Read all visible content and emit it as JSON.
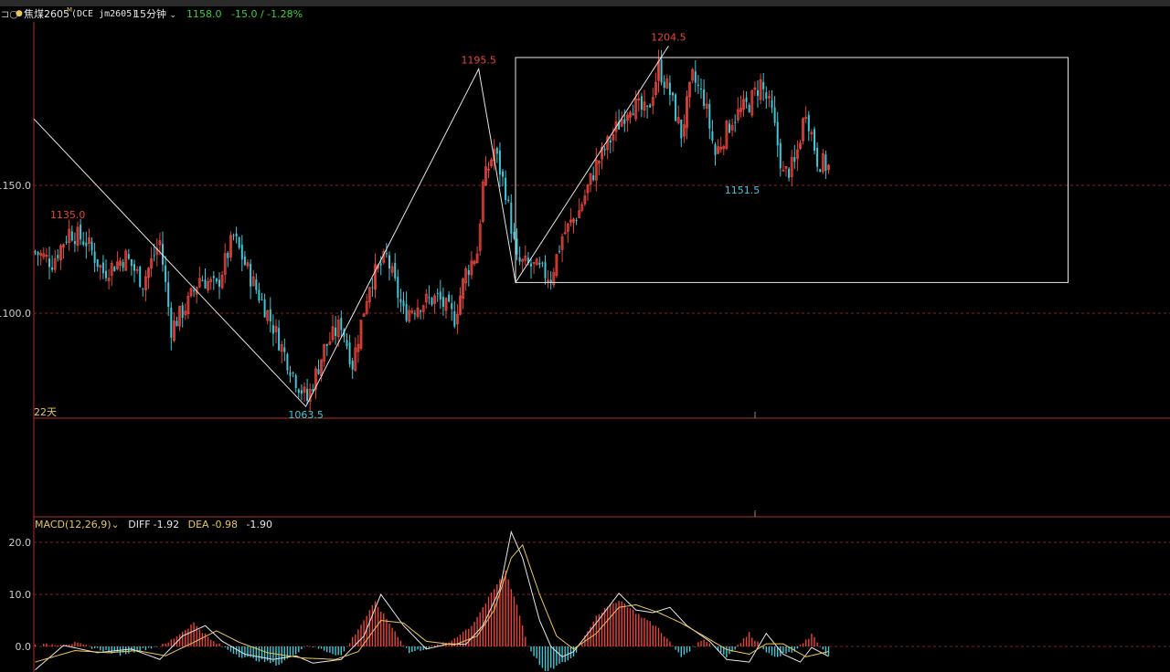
{
  "header": {
    "window_icon": "⊐○",
    "dot": "●",
    "symbol": "焦煤2605",
    "symbol_suffix": "M",
    "exchange_code": "(DCE jm2605)",
    "period": "15分钟",
    "last_price": "1158.0",
    "change": "-15.0 / -1.28%"
  },
  "colors": {
    "up": "#e8443a",
    "down": "#3ec8d8",
    "grid": "#8a1f1f",
    "axis": "#b03030",
    "white": "#e6e6e6",
    "yellow": "#e8c75a",
    "green_text": "#38d238"
  },
  "volume_panel": {
    "label": "22天"
  },
  "macd": {
    "label": "MACD(12,26,9)",
    "diff_label": "DIFF",
    "diff_value": "-1.92",
    "dea_label": "DEA",
    "dea_value": "-0.98",
    "macd_value": "-1.90"
  },
  "chart_data": {
    "type": "candlestick",
    "price_ticks": [
      "1150.0",
      "1100.0"
    ],
    "price_tick_values": [
      1150,
      1100
    ],
    "macd_ticks": [
      "20.0",
      "10.0",
      "0.0"
    ],
    "macd_tick_values": [
      20,
      10,
      0
    ],
    "bar_count": 260,
    "price_range": [
      1058,
      1212
    ],
    "macd_range": [
      -5,
      23
    ],
    "annotations": [
      {
        "text": "1135.0",
        "bar": 12,
        "value": 1135.0,
        "kind": "high"
      },
      {
        "text": "1063.5",
        "bar": 96,
        "value": 1063.5,
        "kind": "low"
      },
      {
        "text": "1195.5",
        "bar": 157,
        "value": 1195.5,
        "kind": "high"
      },
      {
        "text": "1204.5",
        "bar": 224,
        "value": 1204.5,
        "kind": "high"
      },
      {
        "text": "1151.5",
        "bar": 250,
        "value": 1151.5,
        "kind": "low"
      }
    ],
    "zigzag": [
      {
        "bar": 0,
        "value": 1176
      },
      {
        "bar": 96,
        "value": 1063.5
      },
      {
        "bar": 157,
        "value": 1195.5
      },
      {
        "bar": 170,
        "value": 1112
      },
      {
        "bar": 224,
        "value": 1204.5
      }
    ],
    "box": {
      "bar_start": 170,
      "bar_end": 365,
      "high": 1200,
      "low": 1112
    },
    "price_anchors": [
      [
        0,
        1124
      ],
      [
        6,
        1120
      ],
      [
        12,
        1132
      ],
      [
        18,
        1128
      ],
      [
        24,
        1116
      ],
      [
        32,
        1122
      ],
      [
        38,
        1112
      ],
      [
        44,
        1128
      ],
      [
        48,
        1094
      ],
      [
        54,
        1104
      ],
      [
        58,
        1114
      ],
      [
        64,
        1110
      ],
      [
        70,
        1130
      ],
      [
        76,
        1114
      ],
      [
        82,
        1100
      ],
      [
        88,
        1084
      ],
      [
        92,
        1074
      ],
      [
        96,
        1066
      ],
      [
        102,
        1086
      ],
      [
        108,
        1096
      ],
      [
        112,
        1080
      ],
      [
        118,
        1112
      ],
      [
        124,
        1122
      ],
      [
        130,
        1100
      ],
      [
        136,
        1104
      ],
      [
        142,
        1106
      ],
      [
        148,
        1098
      ],
      [
        152,
        1116
      ],
      [
        156,
        1124
      ],
      [
        158,
        1150
      ],
      [
        162,
        1164
      ],
      [
        166,
        1148
      ],
      [
        170,
        1120
      ],
      [
        176,
        1118
      ],
      [
        182,
        1114
      ],
      [
        186,
        1130
      ],
      [
        192,
        1140
      ],
      [
        198,
        1158
      ],
      [
        204,
        1170
      ],
      [
        210,
        1182
      ],
      [
        216,
        1178
      ],
      [
        220,
        1196
      ],
      [
        224,
        1186
      ],
      [
        228,
        1170
      ],
      [
        232,
        1192
      ],
      [
        236,
        1184
      ],
      [
        240,
        1162
      ],
      [
        246,
        1176
      ],
      [
        252,
        1182
      ],
      [
        256,
        1190
      ],
      [
        260,
        1178
      ],
      [
        264,
        1154
      ],
      [
        268,
        1158
      ],
      [
        272,
        1180
      ],
      [
        276,
        1160
      ],
      [
        280,
        1157
      ]
    ],
    "macd_anchors": [
      [
        0,
        0.2
      ],
      [
        14,
        0.6
      ],
      [
        30,
        -1.5
      ],
      [
        46,
        0.4
      ],
      [
        56,
        4.5
      ],
      [
        62,
        1.2
      ],
      [
        72,
        -1.8
      ],
      [
        86,
        -3.5
      ],
      [
        96,
        0.3
      ],
      [
        108,
        -1.8
      ],
      [
        120,
        8.5
      ],
      [
        132,
        -1.2
      ],
      [
        146,
        0.8
      ],
      [
        154,
        4
      ],
      [
        162,
        11
      ],
      [
        166,
        14.5
      ],
      [
        170,
        8
      ],
      [
        174,
        0
      ],
      [
        180,
        -5
      ],
      [
        190,
        -2
      ],
      [
        198,
        6
      ],
      [
        206,
        9
      ],
      [
        212,
        6.5
      ],
      [
        220,
        3.5
      ],
      [
        228,
        -2
      ],
      [
        236,
        1.5
      ],
      [
        244,
        -2
      ],
      [
        252,
        2.5
      ],
      [
        260,
        -2
      ],
      [
        268,
        -1
      ],
      [
        274,
        2.2
      ],
      [
        280,
        -1.9
      ]
    ],
    "diff_anchors": [
      [
        0,
        -4.5
      ],
      [
        10,
        0.2
      ],
      [
        22,
        -1.2
      ],
      [
        34,
        -0.5
      ],
      [
        44,
        -2.5
      ],
      [
        52,
        2
      ],
      [
        60,
        4
      ],
      [
        66,
        1
      ],
      [
        74,
        -1.5
      ],
      [
        84,
        -2.5
      ],
      [
        92,
        -1.8
      ],
      [
        98,
        -3.2
      ],
      [
        108,
        -2.5
      ],
      [
        116,
        2
      ],
      [
        122,
        10
      ],
      [
        130,
        4
      ],
      [
        138,
        -0.5
      ],
      [
        146,
        0.5
      ],
      [
        152,
        0.4
      ],
      [
        158,
        4
      ],
      [
        164,
        11
      ],
      [
        168,
        22
      ],
      [
        172,
        17
      ],
      [
        178,
        5
      ],
      [
        182,
        0
      ],
      [
        186,
        -2
      ],
      [
        190,
        -1
      ],
      [
        198,
        4.5
      ],
      [
        206,
        10.2
      ],
      [
        212,
        7
      ],
      [
        218,
        6.5
      ],
      [
        224,
        7.5
      ],
      [
        230,
        4
      ],
      [
        238,
        1
      ],
      [
        244,
        -2.5
      ],
      [
        252,
        -3
      ],
      [
        258,
        2.5
      ],
      [
        264,
        -1.5
      ],
      [
        270,
        -3
      ],
      [
        274,
        -0.2
      ],
      [
        280,
        -1.92
      ]
    ],
    "dea_anchors": [
      [
        0,
        -3
      ],
      [
        14,
        -0.8
      ],
      [
        26,
        -1.2
      ],
      [
        36,
        -0.8
      ],
      [
        46,
        -1.8
      ],
      [
        56,
        0.8
      ],
      [
        64,
        3
      ],
      [
        72,
        0.8
      ],
      [
        82,
        -1.2
      ],
      [
        94,
        -2.2
      ],
      [
        106,
        -2.5
      ],
      [
        114,
        -1
      ],
      [
        122,
        5
      ],
      [
        130,
        4.5
      ],
      [
        138,
        1
      ],
      [
        148,
        0.3
      ],
      [
        156,
        2
      ],
      [
        162,
        7
      ],
      [
        168,
        17
      ],
      [
        172,
        19.5
      ],
      [
        178,
        10
      ],
      [
        184,
        2
      ],
      [
        190,
        -0.5
      ],
      [
        198,
        2.5
      ],
      [
        206,
        7.5
      ],
      [
        212,
        8
      ],
      [
        220,
        6.5
      ],
      [
        228,
        4.5
      ],
      [
        236,
        2
      ],
      [
        244,
        -0.6
      ],
      [
        252,
        -1.5
      ],
      [
        258,
        0.5
      ],
      [
        264,
        0.5
      ],
      [
        272,
        -2
      ],
      [
        280,
        -0.98
      ]
    ]
  }
}
